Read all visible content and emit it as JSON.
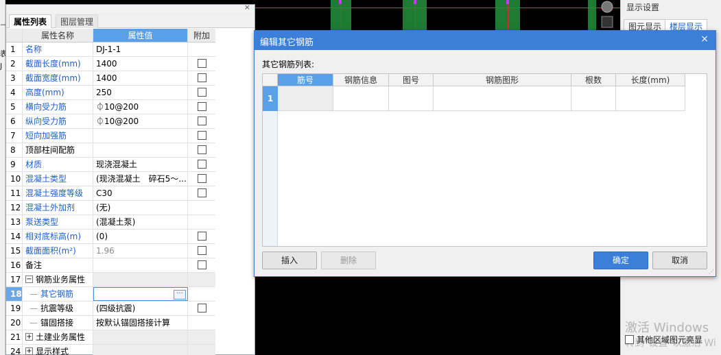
{
  "left_sliver": {
    "chars": [
      "⊣",
      "表",
      "J"
    ]
  },
  "property_panel": {
    "close_glyph": "×",
    "tabs": [
      {
        "label": "属性列表",
        "active": true
      },
      {
        "label": "图层管理",
        "active": false
      }
    ],
    "columns": {
      "name": "属性名称",
      "value": "属性值",
      "add": "附加"
    },
    "rows": [
      {
        "num": "1",
        "name": "名称",
        "value": "DJ-1-1",
        "link": true,
        "checkbox": false
      },
      {
        "num": "2",
        "name": "截面长度(mm)",
        "value": "1400",
        "link": true,
        "checkbox": true
      },
      {
        "num": "3",
        "name": "截面宽度(mm)",
        "value": "1400",
        "link": true,
        "checkbox": true
      },
      {
        "num": "4",
        "name": "高度(mm)",
        "value": "250",
        "link": true,
        "checkbox": true
      },
      {
        "num": "5",
        "name": "横向受力筋",
        "value": "⏀10@200",
        "link": true,
        "checkbox": true
      },
      {
        "num": "6",
        "name": "纵向受力筋",
        "value": "⏀10@200",
        "link": true,
        "checkbox": true
      },
      {
        "num": "7",
        "name": "短向加强筋",
        "value": "",
        "link": true,
        "checkbox": true
      },
      {
        "num": "8",
        "name": "顶部柱间配筋",
        "value": "",
        "link": false,
        "checkbox": true
      },
      {
        "num": "9",
        "name": "材质",
        "value": "现浇混凝土",
        "link": true,
        "checkbox": true
      },
      {
        "num": "10",
        "name": "混凝土类型",
        "value": "(现浇混凝土　碎石5～...",
        "link": true,
        "checkbox": true
      },
      {
        "num": "11",
        "name": "混凝土强度等级",
        "value": "C30",
        "link": true,
        "checkbox": true
      },
      {
        "num": "12",
        "name": "混凝土外加剂",
        "value": "(无)",
        "link": true,
        "checkbox": false
      },
      {
        "num": "13",
        "name": "泵送类型",
        "value": "(混凝土泵)",
        "link": true,
        "checkbox": false
      },
      {
        "num": "14",
        "name": "相对底标高(m)",
        "value": "(0)",
        "link": true,
        "checkbox": true
      },
      {
        "num": "15",
        "name": "截面面积(m²)",
        "value": "1.96",
        "link": true,
        "checkbox": true,
        "gray": true
      },
      {
        "num": "16",
        "name": "备注",
        "value": "",
        "link": false,
        "checkbox": true
      },
      {
        "num": "17",
        "name": "钢筋业务属性",
        "value": "",
        "link": false,
        "checkbox": false,
        "expander": "−",
        "graybg": true
      },
      {
        "num": "18",
        "name": "其它钢筋",
        "value": "",
        "link": true,
        "checkbox": false,
        "sub": true,
        "selected": true,
        "ellipsis": "···"
      },
      {
        "num": "19",
        "name": "抗震等级",
        "value": "(四级抗震)",
        "link": false,
        "checkbox": true,
        "sub": true
      },
      {
        "num": "20",
        "name": "锚固搭接",
        "value": "按默认锚固搭接计算",
        "link": false,
        "checkbox": false,
        "sub": true
      },
      {
        "num": "21",
        "name": "土建业务属性",
        "value": "",
        "link": false,
        "checkbox": false,
        "expander": "+",
        "graybg": true
      },
      {
        "num": "24",
        "name": "显示样式",
        "value": "",
        "link": false,
        "checkbox": false,
        "expander": "+",
        "graybg": true
      }
    ]
  },
  "right_panel": {
    "title": "显示设置",
    "tabs": [
      {
        "label": "图元显示",
        "blue": false
      },
      {
        "label": "楼层显示",
        "blue": true
      }
    ],
    "watermark_line1": "激活 Windows",
    "watermark_line2": "转到\"设置\"以激活 Wi",
    "bottom_checkbox_label": "其他区域图元亮显"
  },
  "dialog": {
    "title": "编辑其它钢筋",
    "close_glyph": "×",
    "list_label": "其它钢筋列表:",
    "columns": [
      "筋号",
      "钢筋信息",
      "图号",
      "钢筋图形",
      "根数",
      "长度(mm)"
    ],
    "row_number": "1",
    "buttons": {
      "insert": "插入",
      "delete": "删除",
      "ok": "确定",
      "cancel": "取消"
    },
    "resize_glyph": "⋰"
  },
  "colors": {
    "accent": "#3b7fd9",
    "link": "#1b5fc9",
    "canvas": "#000000",
    "canvas_green": "#1f7a33"
  }
}
